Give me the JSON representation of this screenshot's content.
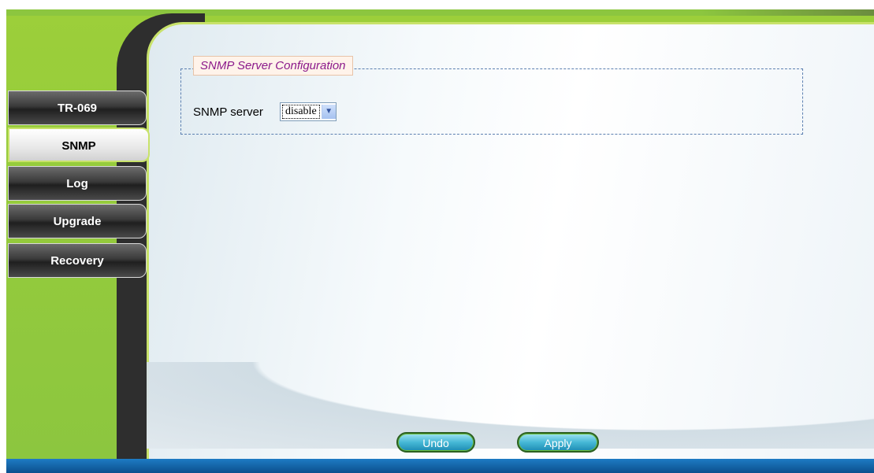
{
  "sidebar": {
    "tabs": [
      {
        "label": "TR-069",
        "active": false
      },
      {
        "label": "SNMP",
        "active": true
      },
      {
        "label": "Log",
        "active": false
      },
      {
        "label": "Upgrade",
        "active": false
      },
      {
        "label": "Recovery",
        "active": false
      }
    ]
  },
  "snmp": {
    "legend": "SNMP Server Configuration",
    "server_label": "SNMP server",
    "server_value": "disable"
  },
  "actions": {
    "undo_label": "Undo",
    "apply_label": "Apply"
  },
  "colors": {
    "frame_green": "#8cc63f",
    "legend_text": "#8b1a8b",
    "bottom_bar": "#0b4f8d"
  }
}
